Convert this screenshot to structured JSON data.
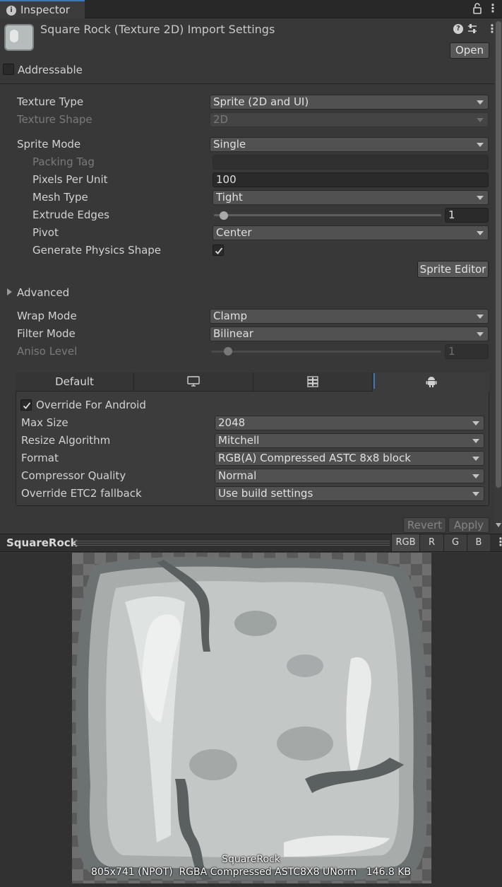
{
  "tab": {
    "title": "Inspector"
  },
  "header": {
    "title": "Square Rock (Texture 2D) Import Settings",
    "open_label": "Open"
  },
  "addressable": {
    "label": "Addressable",
    "checked": false
  },
  "settings": {
    "texture_type": {
      "label": "Texture Type",
      "value": "Sprite (2D and UI)"
    },
    "texture_shape": {
      "label": "Texture Shape",
      "value": "2D"
    },
    "sprite_mode": {
      "label": "Sprite Mode",
      "value": "Single"
    },
    "packing_tag": {
      "label": "Packing Tag",
      "value": ""
    },
    "pixels_per_unit": {
      "label": "Pixels Per Unit",
      "value": "100"
    },
    "mesh_type": {
      "label": "Mesh Type",
      "value": "Tight"
    },
    "extrude_edges": {
      "label": "Extrude Edges",
      "value": "1",
      "max": 32
    },
    "pivot": {
      "label": "Pivot",
      "value": "Center"
    },
    "generate_physics_shape": {
      "label": "Generate Physics Shape",
      "checked": true
    },
    "sprite_editor_label": "Sprite Editor",
    "advanced_label": "Advanced",
    "wrap_mode": {
      "label": "Wrap Mode",
      "value": "Clamp"
    },
    "filter_mode": {
      "label": "Filter Mode",
      "value": "Bilinear"
    },
    "aniso_level": {
      "label": "Aniso Level",
      "value": "1",
      "max": 16
    }
  },
  "platforms": {
    "tabs": [
      {
        "label": "Default",
        "icon": ""
      },
      {
        "label": "",
        "icon": "monitor-icon"
      },
      {
        "label": "",
        "icon": "server-icon"
      },
      {
        "label": "",
        "icon": "android-icon"
      }
    ],
    "active": "android",
    "override_label": "Override For Android",
    "override_checked": true,
    "max_size": {
      "label": "Max Size",
      "value": "2048"
    },
    "resize_algorithm": {
      "label": "Resize Algorithm",
      "value": "Mitchell"
    },
    "format": {
      "label": "Format",
      "value": "RGB(A) Compressed ASTC 8x8 block"
    },
    "compressor_quality": {
      "label": "Compressor Quality",
      "value": "Normal"
    },
    "etc2_fallback": {
      "label": "Override ETC2 fallback",
      "value": "Use build settings"
    }
  },
  "actions": {
    "revert_label": "Revert",
    "apply_label": "Apply"
  },
  "preview": {
    "title": "SquareRock",
    "channels": [
      "RGB",
      "R",
      "G",
      "B"
    ],
    "active_channel": "RGB",
    "image_name": "SquareRock",
    "info": "805x741 (NPOT)  RGBA Compressed ASTC8X8 UNorm   146.8 KB"
  },
  "colors": {
    "accent": "#3a79bb",
    "panel_bg": "#383838",
    "rock_light": "#c3c8c7",
    "rock_dark": "#6c7171"
  }
}
